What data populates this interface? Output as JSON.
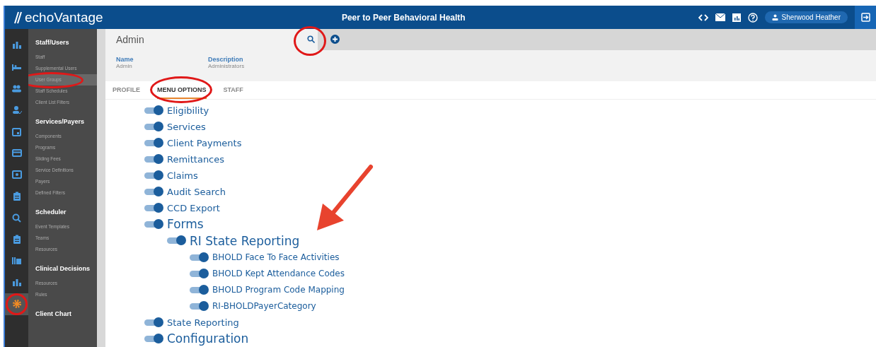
{
  "header": {
    "logo": "echoVantage",
    "title": "Peer to Peer Behavioral Health",
    "user": "Sherwood Heather"
  },
  "rail": [
    {
      "selected": false
    },
    {
      "selected": false
    },
    {
      "selected": false
    },
    {
      "selected": false
    },
    {
      "selected": false
    },
    {
      "selected": false
    },
    {
      "selected": false
    },
    {
      "selected": false
    },
    {
      "selected": false
    },
    {
      "selected": false
    },
    {
      "selected": false
    },
    {
      "selected": false
    },
    {
      "selected": true
    }
  ],
  "sidebar": [
    {
      "heading": "Staff/Users",
      "items": [
        {
          "label": "Staff",
          "selected": false
        },
        {
          "label": "Supplemental Users",
          "selected": false
        },
        {
          "label": "User Groups",
          "selected": true
        },
        {
          "label": "Staff Schedules",
          "selected": false
        },
        {
          "label": "Client List Filters",
          "selected": false
        }
      ]
    },
    {
      "heading": "Services/Payers",
      "items": [
        {
          "label": "Components",
          "selected": false
        },
        {
          "label": "Programs",
          "selected": false
        },
        {
          "label": "Sliding Fees",
          "selected": false
        },
        {
          "label": "Service Definitions",
          "selected": false
        },
        {
          "label": "Payers",
          "selected": false
        },
        {
          "label": "Defined Filters",
          "selected": false
        }
      ]
    },
    {
      "heading": "Scheduler",
      "items": [
        {
          "label": "Event Templates",
          "selected": false
        },
        {
          "label": "Teams",
          "selected": false
        },
        {
          "label": "Resources",
          "selected": false
        }
      ]
    },
    {
      "heading": "Clinical Decisions",
      "items": [
        {
          "label": "Resources",
          "selected": false
        },
        {
          "label": "Rules",
          "selected": false
        }
      ]
    },
    {
      "heading": "Client Chart"
    }
  ],
  "record": {
    "title": "Admin",
    "fields": [
      {
        "label": "Name",
        "value": "Admin"
      },
      {
        "label": "Description",
        "value": "Administrators"
      }
    ]
  },
  "tabs": [
    {
      "label": "PROFILE",
      "selected": false
    },
    {
      "label": "MENU OPTIONS",
      "selected": true
    },
    {
      "label": "STAFF",
      "selected": false
    }
  ],
  "tree": [
    {
      "label": "Eligibility",
      "on": true,
      "kind": "item"
    },
    {
      "label": "Services",
      "on": true,
      "kind": "item"
    },
    {
      "label": "Client Payments",
      "on": true,
      "kind": "item"
    },
    {
      "label": "Remittances",
      "on": true,
      "kind": "item"
    },
    {
      "label": "Claims",
      "on": true,
      "kind": "item"
    },
    {
      "label": "Audit Search",
      "on": true,
      "kind": "item"
    },
    {
      "label": "CCD Export",
      "on": true,
      "kind": "item"
    },
    {
      "label": "Forms",
      "on": true,
      "kind": "section",
      "children": [
        {
          "label": "RI State Reporting",
          "on": true,
          "kind": "section",
          "children": [
            {
              "label": "BHOLD Face To Face Activities",
              "on": true,
              "kind": "item"
            },
            {
              "label": "BHOLD Kept Attendance Codes",
              "on": true,
              "kind": "item"
            },
            {
              "label": "BHOLD Program Code Mapping",
              "on": true,
              "kind": "item"
            },
            {
              "label": "RI-BHOLDPayerCategory",
              "on": true,
              "kind": "item"
            }
          ]
        }
      ]
    },
    {
      "label": "State Reporting",
      "on": true,
      "kind": "item"
    },
    {
      "label": "Configuration",
      "on": true,
      "kind": "section"
    }
  ]
}
